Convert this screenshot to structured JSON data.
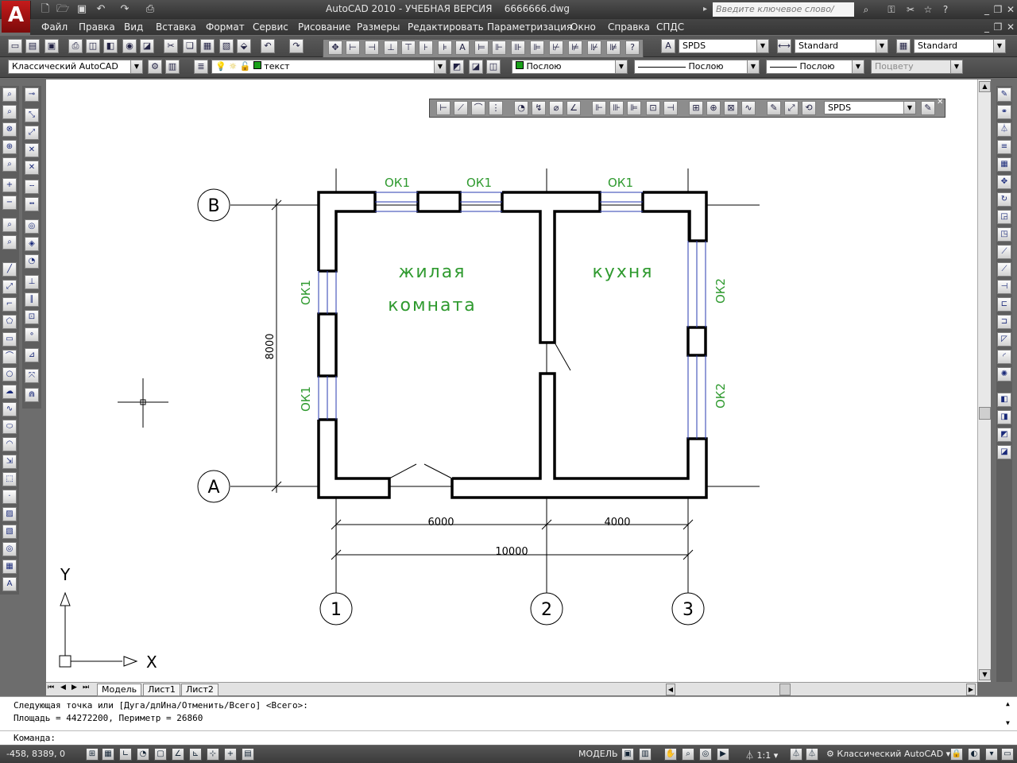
{
  "app": {
    "logo": "A",
    "title": "AutoCAD 2010 - УЧЕБНАЯ ВЕРСИЯ    6666666.dwg",
    "search_placeholder": "Введите ключевое слово/фразу"
  },
  "menu": [
    "Файл",
    "Правка",
    "Вид",
    "Вставка",
    "Формат",
    "Сервис",
    "Рисование",
    "Размеры",
    "Редактировать",
    "Параметризация",
    "Окно",
    "Справка",
    "СПДС"
  ],
  "toolbar": {
    "text_style": "SPDS",
    "dim_style": "Standard",
    "table_style": "Standard",
    "workspace": "Классический AutoCAD",
    "layer": "текст",
    "color": "Послою",
    "linetype": "Послою",
    "lineweight": "Послою",
    "plotstyle": "Поцвету",
    "dim_toolbar_style": "SPDS"
  },
  "drawing": {
    "room_living_1": "жилая",
    "room_living_2": "комната",
    "room_kitchen": "кухня",
    "window_top_1": "ОК1",
    "window_top_2": "ОК1",
    "window_top_3": "ОК1",
    "window_left_1": "ОК1",
    "window_left_2": "ОК1",
    "window_right_1": "ОК2",
    "window_right_2": "ОК2",
    "dim_height": "8000",
    "dim_6000": "6000",
    "dim_4000": "4000",
    "dim_10000": "10000",
    "axis_v": "В",
    "axis_a": "А",
    "axis_1": "1",
    "axis_2": "2",
    "axis_3": "3",
    "ucs_x": "X",
    "ucs_y": "Y"
  },
  "tabs": [
    "Модель",
    "Лист1",
    "Лист2"
  ],
  "command": {
    "line1": "Следующая точка или [Дуга/длИна/Отменить/Всего] <Всего>:",
    "line2": "Площадь = 44272200, Периметр = 26860",
    "prompt": "Команда:"
  },
  "status": {
    "coords": "-458, 8389, 0",
    "model": "МОДЕЛЬ",
    "scale": "1:1",
    "workspace": "Классический AutoCAD"
  },
  "colors": {
    "canvas": "#ffffff",
    "wall": "#000000",
    "window_line": "#2a3bb0",
    "label_green": "#2f9a2f",
    "chrome": "#4a4a4a"
  }
}
